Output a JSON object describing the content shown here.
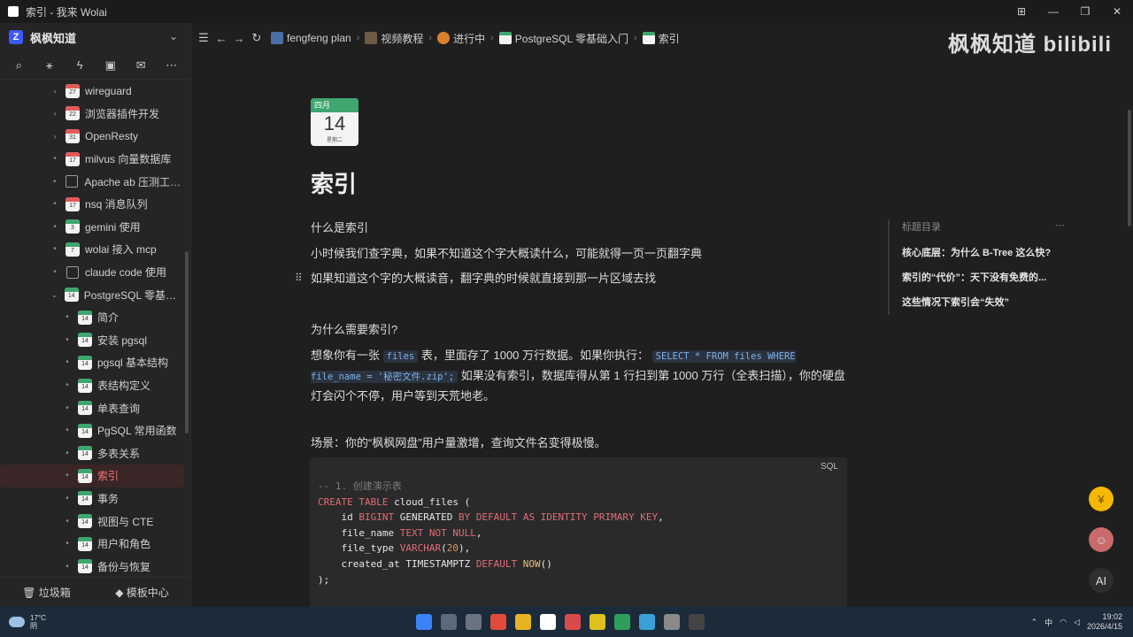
{
  "window": {
    "title": "索引 - 我来 Wolai"
  },
  "workspace": {
    "name": "枫枫知道"
  },
  "sidebar": {
    "items": [
      {
        "label": "wireguard",
        "num": "27",
        "expand": "arrow",
        "icon": "cal-red"
      },
      {
        "label": "浏览器插件开发",
        "num": "22",
        "expand": "arrow",
        "icon": "cal-red"
      },
      {
        "label": "OpenResty",
        "num": "31",
        "expand": "arrow",
        "icon": "cal-red"
      },
      {
        "label": "milvus 向量数据库",
        "num": "17",
        "expand": "dot",
        "icon": "cal-red"
      },
      {
        "label": "Apache ab 压测工具...",
        "num": "",
        "expand": "dot",
        "icon": "doc"
      },
      {
        "label": "nsq 消息队列",
        "num": "17",
        "expand": "dot",
        "icon": "cal-red"
      },
      {
        "label": "gemini 使用",
        "num": "3",
        "expand": "dot",
        "icon": "cal-green"
      },
      {
        "label": "wolai 接入 mcp",
        "num": "7",
        "expand": "dot",
        "icon": "cal-green"
      },
      {
        "label": "claude code 使用",
        "num": "",
        "expand": "dot",
        "icon": "doc"
      },
      {
        "label": "PostgreSQL 零基础入...",
        "num": "14",
        "expand": "open",
        "icon": "cal-green"
      }
    ],
    "children": [
      {
        "label": "简介",
        "num": "14"
      },
      {
        "label": "安装 pgsql",
        "num": "14"
      },
      {
        "label": "pgsql 基本结构",
        "num": "14"
      },
      {
        "label": "表结构定义",
        "num": "14"
      },
      {
        "label": "单表查询",
        "num": "14"
      },
      {
        "label": "PgSQL 常用函数",
        "num": "14"
      },
      {
        "label": "多表关系",
        "num": "14"
      },
      {
        "label": "索引",
        "num": "14",
        "active": true
      },
      {
        "label": "事务",
        "num": "14"
      },
      {
        "label": "视图与 CTE",
        "num": "14"
      },
      {
        "label": "用户和角色",
        "num": "14"
      },
      {
        "label": "备份与恢复",
        "num": "14"
      }
    ],
    "footer": {
      "trash": "垃圾箱",
      "templates": "模板中心"
    }
  },
  "breadcrumb": [
    "fengfeng plan",
    "视频教程",
    "进行中",
    "PostgreSQL 零基础入门",
    "索引"
  ],
  "watermark": "枫枫知道 bilibili",
  "page": {
    "cover": {
      "month": "四月",
      "day": "14",
      "weekday": "星期二"
    },
    "title": "索引",
    "p1": "什么是索引",
    "p2": "小时候我们查字典，如果不知道这个字大概读什么，可能就得一页一页翻字典",
    "p3": "如果知道这个字的大概读音，翻字典的时候就直接到那一片区域去找",
    "h_why": "为什么需要索引?",
    "p4_a": "想象你有一张",
    "p4_code1": "files",
    "p4_b": "表，里面存了 1000 万行数据。如果你执行：",
    "p4_code2": "SELECT * FROM files WHERE file_name = '秘密文件.zip';",
    "p4_c": "如果没有索引，数据库得从第 1 行扫到第 1000 万行（全表扫描），你的硬盘灯会闪个不停，用户等到天荒地老。",
    "p5": "场景：你的“枫枫网盘”用户量激增，查询文件名变得极慢。",
    "code_lang": "SQL"
  },
  "outline": {
    "title": "标题目录",
    "items": [
      "核心底层：为什么 B-Tree 这么快?",
      "索引的“代价”：天下没有免费的...",
      "这些情况下索引会“失效”"
    ]
  },
  "taskbar": {
    "weather_temp": "17°C",
    "weather_desc": "阴",
    "ime": "中",
    "time": "19:02",
    "date": "2026/4/15"
  }
}
